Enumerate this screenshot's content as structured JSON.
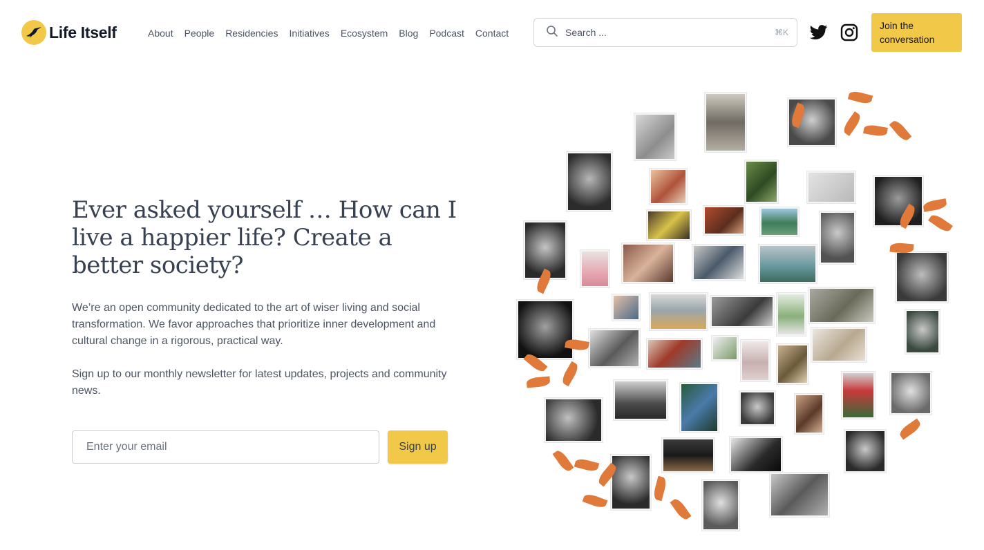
{
  "brand": {
    "name": "Life Itself",
    "accent": "#f2c849",
    "leaf_color": "#e07a3a"
  },
  "nav": {
    "items": [
      {
        "label": "About"
      },
      {
        "label": "People"
      },
      {
        "label": "Residencies"
      },
      {
        "label": "Initiatives"
      },
      {
        "label": "Ecosystem"
      },
      {
        "label": "Blog"
      },
      {
        "label": "Podcast"
      },
      {
        "label": "Contact"
      }
    ]
  },
  "search": {
    "placeholder": "Search ...",
    "shortcut": "⌘K",
    "icon": "search-icon"
  },
  "social": {
    "twitter_icon": "twitter-icon",
    "instagram_icon": "instagram-icon"
  },
  "cta": {
    "join_label": "Join the conversation"
  },
  "hero": {
    "headline": "Ever asked yourself … How can I live a happier life? Create a better society?",
    "description": "We’re an open community dedicated to the art of wiser living and social transformation. We favor approaches that prioritize inner development and cultural change in a rigorous, practical way.",
    "newsletter_text": "Sign up to our monthly newsletter for latest updates, projects and community news."
  },
  "newsletter": {
    "email_placeholder": "Enter your email",
    "signup_label": "Sign up"
  }
}
